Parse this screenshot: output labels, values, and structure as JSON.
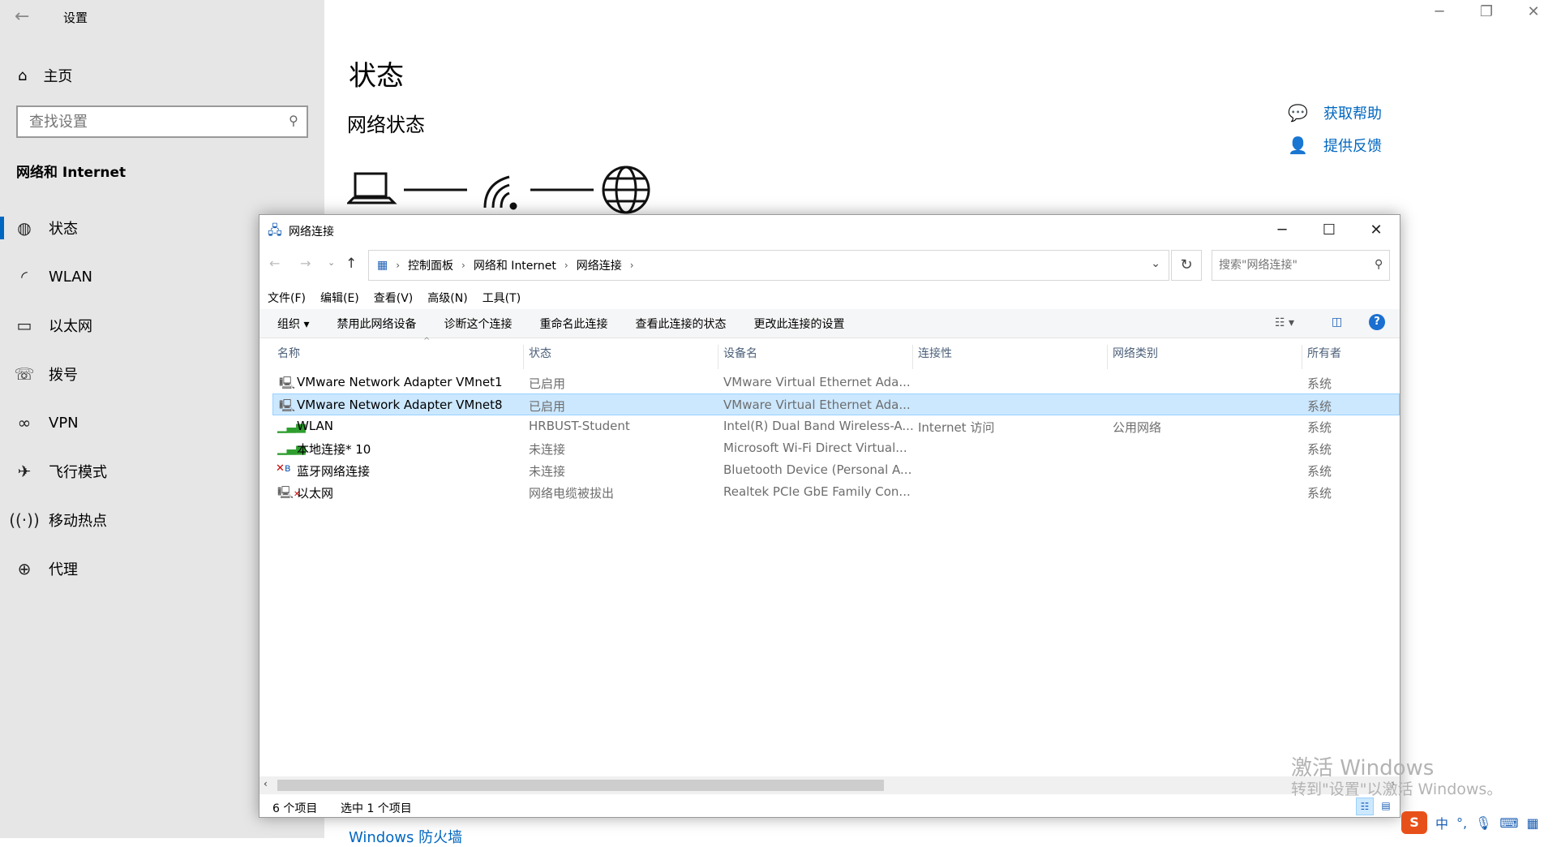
{
  "settings": {
    "window_title": "设置",
    "home_label": "主页",
    "search_placeholder": "查找设置",
    "section_title": "网络和 Internet",
    "nav": [
      {
        "label": "状态",
        "icon": "globe-status-icon"
      },
      {
        "label": "WLAN",
        "icon": "wifi-icon"
      },
      {
        "label": "以太网",
        "icon": "ethernet-icon"
      },
      {
        "label": "拨号",
        "icon": "dialup-icon"
      },
      {
        "label": "VPN",
        "icon": "vpn-icon"
      },
      {
        "label": "飞行模式",
        "icon": "airplane-icon"
      },
      {
        "label": "移动热点",
        "icon": "hotspot-icon"
      },
      {
        "label": "代理",
        "icon": "globe-icon"
      }
    ],
    "page_title": "状态",
    "sub_title": "网络状态",
    "help_label": "获取帮助",
    "feedback_label": "提供反馈",
    "bottom_link": "Windows 防火墙"
  },
  "explorer": {
    "title": "网络连接",
    "breadcrumb": [
      "控制面板",
      "网络和 Internet",
      "网络连接"
    ],
    "search_placeholder": "搜索\"网络连接\"",
    "menu": [
      "文件(F)",
      "编辑(E)",
      "查看(V)",
      "高级(N)",
      "工具(T)"
    ],
    "commands": [
      "组织 ▾",
      "禁用此网络设备",
      "诊断这个连接",
      "重命名此连接",
      "查看此连接的状态",
      "更改此连接的设置"
    ],
    "columns": [
      "名称",
      "状态",
      "设备名",
      "连接性",
      "网络类别",
      "所有者"
    ],
    "rows": [
      {
        "name": "VMware Network Adapter VMnet1",
        "status": "已启用",
        "device": "VMware Virtual Ethernet Ada...",
        "connectivity": "",
        "category": "",
        "owner": "系统"
      },
      {
        "name": "VMware Network Adapter VMnet8",
        "status": "已启用",
        "device": "VMware Virtual Ethernet Ada...",
        "connectivity": "",
        "category": "",
        "owner": "系统"
      },
      {
        "name": "WLAN",
        "status": "HRBUST-Student",
        "device": "Intel(R) Dual Band Wireless-A...",
        "connectivity": "Internet 访问",
        "category": "公用网络",
        "owner": "系统"
      },
      {
        "name": "本地连接* 10",
        "status": "未连接",
        "device": "Microsoft Wi-Fi Direct Virtual...",
        "connectivity": "",
        "category": "",
        "owner": "系统"
      },
      {
        "name": "蓝牙网络连接",
        "status": "未连接",
        "device": "Bluetooth Device (Personal A...",
        "connectivity": "",
        "category": "",
        "owner": "系统"
      },
      {
        "name": "以太网",
        "status": "网络电缆被拔出",
        "device": "Realtek PCIe GbE Family Con...",
        "connectivity": "",
        "category": "",
        "owner": "系统"
      }
    ],
    "item_count": "6 个项目",
    "selected_count": "选中 1 个项目"
  },
  "watermark": {
    "line1": "激活 Windows",
    "line2": "转到\"设置\"以激活 Windows。"
  },
  "tray": {
    "ime": "中",
    "punct": "°,"
  },
  "colors": {
    "accent": "#0067c0",
    "selection": "#cce8ff",
    "sidebar_bg": "#e6e6e6"
  }
}
